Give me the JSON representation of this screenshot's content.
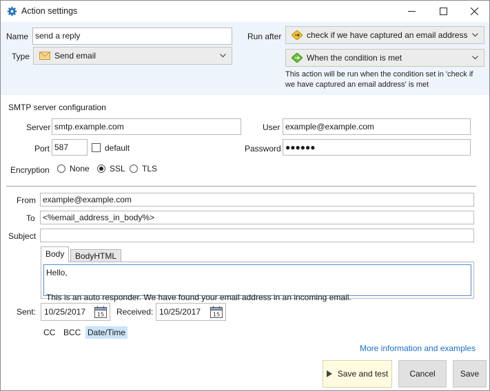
{
  "window": {
    "title": "Action settings",
    "controls": {
      "minimize": "minimize-icon",
      "maximize": "maximize-icon",
      "close": "close-icon"
    }
  },
  "action": {
    "name_label": "Name",
    "name_value": "send a reply",
    "type_label": "Type",
    "type_value": "Send email",
    "run_after_label": "Run after",
    "run_after_value": "check if we have captured an email address",
    "condition_value": "When the condition is met",
    "note_line1": "This action will be run when the condition set in 'check if",
    "note_line2": "we have captured an email address' is met"
  },
  "smtp": {
    "section_title": "SMTP server configuration",
    "server_label": "Server",
    "server_value": "smtp.example.com",
    "user_label": "User",
    "user_value": "example@example.com",
    "port_label": "Port",
    "port_value": "587",
    "default_label": "default",
    "default_checked": false,
    "password_label": "Password",
    "password_value": "●●●●●●",
    "encryption_label": "Encryption",
    "encryption_options": [
      "None",
      "SSL",
      "TLS"
    ],
    "encryption_selected": "SSL"
  },
  "email": {
    "from_label": "From",
    "from_value": "example@example.com",
    "to_label": "To",
    "to_value": "<%email_address_in_body%>",
    "subject_label": "Subject",
    "subject_value": "",
    "tabs": [
      "Body",
      "BodyHTML"
    ],
    "active_tab": "Body",
    "body_line1": "Hello,",
    "body_line2": "",
    "body_line3": "This is an auto responder. We have found your email address in an incoming email.",
    "sent_label": "Sent:",
    "sent_value": "10/25/2017",
    "received_label": "Received:",
    "received_value": "10/25/2017",
    "calendar_day": "15",
    "field_tabs": [
      "CC",
      "BCC",
      "Date/Time"
    ],
    "selected_field_tab": "Date/Time"
  },
  "footer": {
    "more_info_link": "More information and examples",
    "save_and_test": "Save and test",
    "cancel": "Cancel",
    "save": "Save"
  },
  "colors": {
    "top_band": "#eef4fb",
    "link": "#1a6fc9",
    "selected_tab": "#cce4f7",
    "primary_button": "#fffbe0",
    "body_focus_border": "#4d8fd1"
  }
}
